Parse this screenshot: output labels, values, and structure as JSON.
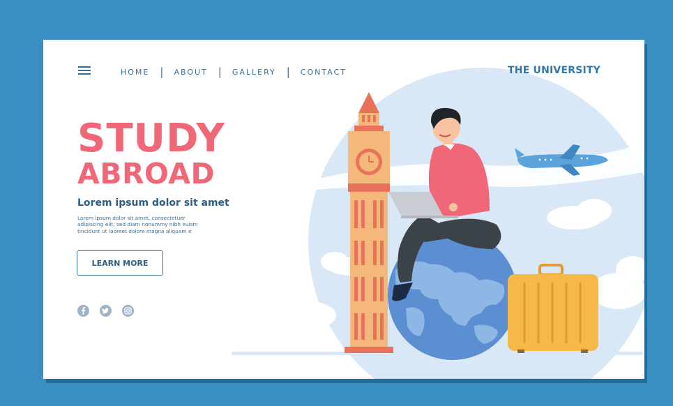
{
  "nav": {
    "items": [
      "HOME",
      "ABOUT",
      "GALLERY",
      "CONTACT"
    ],
    "separator": "|"
  },
  "brand": "THE UNIVERSITY",
  "hero": {
    "title_line1": "STUDY",
    "title_line2": "ABROAD",
    "subtitle": "Lorem ipsum dolor sit amet",
    "body_lines": [
      "Lorem ipsum dolor sit amet, consectetuer",
      "adipiscing elit, sed diam nonummy nibh euism",
      "tincidunt ut laoreet dolore magna aliquam e"
    ],
    "cta_label": "LEARN MORE"
  },
  "social": {
    "icons": [
      "facebook-icon",
      "twitter-icon",
      "instagram-icon"
    ]
  },
  "colors": {
    "background": "#3a8fc2",
    "accent": "#f06878",
    "text": "#2f5e86",
    "brand": "#2e77aa"
  }
}
